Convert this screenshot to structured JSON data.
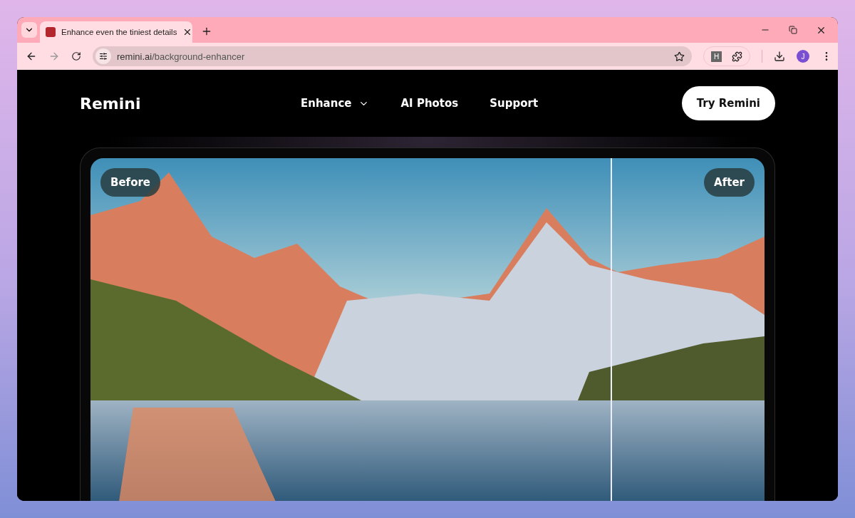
{
  "browser": {
    "tab": {
      "title": "Enhance even the tiniest details",
      "selected": true
    },
    "address": {
      "host": "remini.ai",
      "path": "/background-enhancer"
    },
    "extension_letter": "H",
    "profile_initial": "J"
  },
  "site": {
    "logo": "Remini",
    "nav": [
      {
        "label": "Enhance",
        "dropdown": true
      },
      {
        "label": "AI Photos",
        "dropdown": false
      },
      {
        "label": "Support",
        "dropdown": false
      }
    ],
    "cta": "Try Remini"
  },
  "comparison": {
    "before_label": "Before",
    "after_label": "After",
    "level": 0.772
  }
}
